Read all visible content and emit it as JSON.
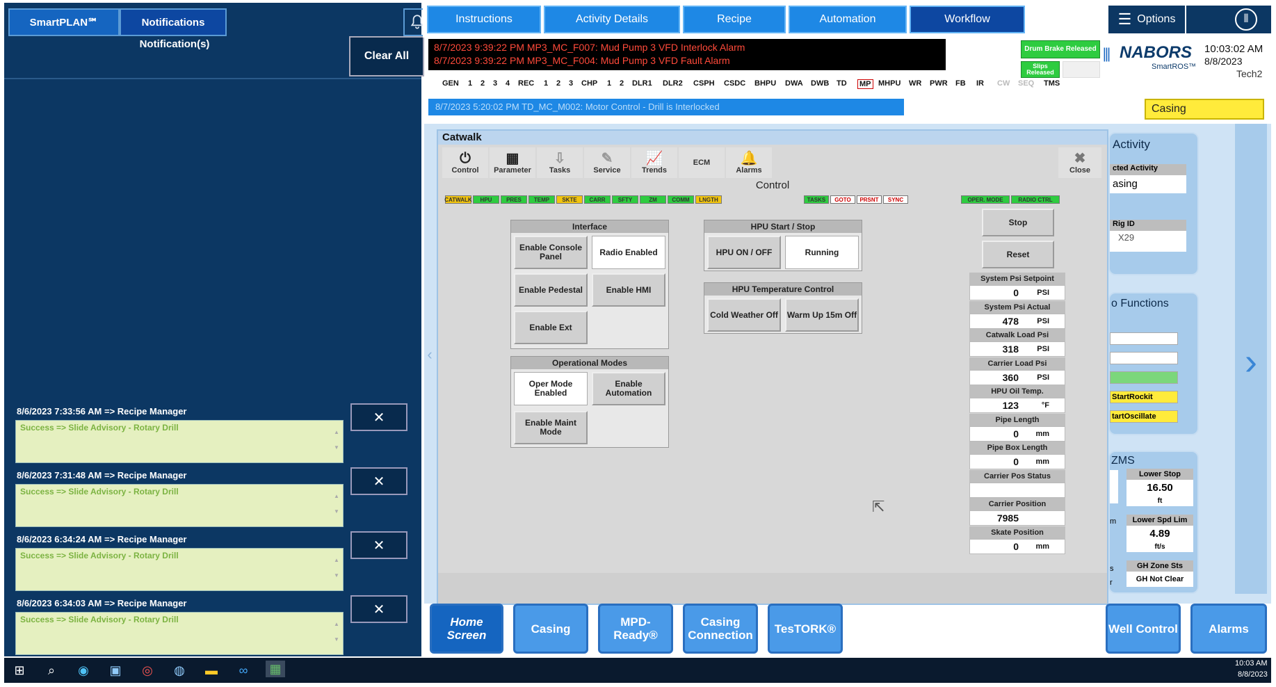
{
  "left": {
    "tabs": [
      "SmartPLAN℠",
      "Notifications"
    ],
    "panel_title": "Notification(s)",
    "clear_all": "Clear All",
    "notifications": [
      {
        "header": "8/6/2023 7:33:56 AM => Recipe Manager",
        "message": "Success => Slide Advisory - Rotary Drill"
      },
      {
        "header": "8/6/2023 7:31:48 AM => Recipe Manager",
        "message": "Success => Slide Advisory - Rotary Drill"
      },
      {
        "header": "8/6/2023 6:34:24 AM => Recipe Manager",
        "message": "Success => Slide Advisory - Rotary Drill"
      },
      {
        "header": "8/6/2023 6:34:03 AM => Recipe Manager",
        "message": "Success => Slide Advisory - Rotary Drill"
      }
    ],
    "dismiss": "✕"
  },
  "nav": {
    "tabs": [
      "Instructions",
      "Activity Details",
      "Recipe",
      "Automation",
      "Workflow"
    ],
    "options": "Options"
  },
  "alarms": [
    "8/7/2023 9:39:22 PM    MP3_MC_F007: Mud Pump 3 VFD Interlock Alarm",
    "8/7/2023 9:39:22 PM    MP3_MC_F004: Mud Pump 3 VFD Fault Alarm"
  ],
  "brake": {
    "drum": "Drum Brake Released",
    "slips": "Slips Released"
  },
  "brand": {
    "name": "NABORS",
    "sub": "SmartROS™",
    "time": "10:03:02 AM",
    "date": "8/8/2023",
    "user": "Tech2"
  },
  "status_labels": [
    "GEN",
    "1",
    "2",
    "3",
    "4",
    "REC",
    "1",
    "2",
    "3",
    "CHP",
    "1",
    "2",
    "DLR1",
    "DLR2",
    "CSPH",
    "CSDC",
    "BHPU",
    "DWA",
    "DWB",
    "TD",
    "MP",
    "MHPU",
    "WR",
    "PWR",
    "FB",
    "IR",
    "CW",
    "SEQ",
    "TMS"
  ],
  "info_message": "8/7/2023 5:20:02 PM       TD_MC_M002: Motor Control - Drill is Interlocked",
  "activity_badge": "Casing",
  "catwalk": {
    "title": "Catwalk",
    "toolbar": [
      {
        "label": "Control",
        "icon": "power-icon"
      },
      {
        "label": "Parameter",
        "icon": "calculator-icon"
      },
      {
        "label": "Tasks",
        "icon": "tasks-icon"
      },
      {
        "label": "Service",
        "icon": "service-icon"
      },
      {
        "label": "Trends",
        "icon": "trends-icon"
      },
      {
        "label": "ECM",
        "icon": ""
      },
      {
        "label": "Alarms",
        "icon": "bell-icon"
      }
    ],
    "close": "Close",
    "section_title": "Control",
    "status_segments_left": [
      {
        "label": "CATWALK",
        "color": "#f1c40f"
      },
      {
        "label": "HPU",
        "color": "#2ecc40"
      },
      {
        "label": "PRES",
        "color": "#2ecc40"
      },
      {
        "label": "TEMP",
        "color": "#2ecc40"
      },
      {
        "label": "SKTE",
        "color": "#f1c40f"
      },
      {
        "label": "CARR",
        "color": "#2ecc40"
      },
      {
        "label": "SFTY",
        "color": "#2ecc40"
      },
      {
        "label": "ZM",
        "color": "#2ecc40"
      },
      {
        "label": "COMM",
        "color": "#2ecc40"
      },
      {
        "label": "LNGTH",
        "color": "#f1c40f"
      }
    ],
    "status_segments_mid": [
      {
        "label": "TASKS",
        "color": "#2ecc40"
      },
      {
        "label": "GOTO",
        "color": "#ffffff"
      },
      {
        "label": "PRSNT",
        "color": "#ffffff"
      },
      {
        "label": "SYNC",
        "color": "#ffffff"
      }
    ],
    "status_segments_right": [
      {
        "label": "OPER. MODE",
        "color": "#2ecc40"
      },
      {
        "label": "RADIO CTRL",
        "color": "#2ecc40"
      }
    ],
    "interface": {
      "title": "Interface",
      "enable_console": "Enable Console Panel",
      "radio_enabled": "Radio Enabled",
      "enable_pedestal": "Enable Pedestal",
      "enable_hmi": "Enable HMI",
      "enable_ext": "Enable Ext"
    },
    "hpu": {
      "title": "HPU Start / Stop",
      "onoff": "HPU ON / OFF",
      "running": "Running",
      "temp_title": "HPU Temperature Control",
      "cold": "Cold Weather Off",
      "warm": "Warm Up 15m Off"
    },
    "modes": {
      "title": "Operational Modes",
      "oper": "Oper Mode Enabled",
      "auto": "Enable Automation",
      "maint": "Enable Maint Mode"
    },
    "stop": "Stop",
    "reset": "Reset",
    "readouts": [
      {
        "label": "System Psi Setpoint",
        "value": "0",
        "unit": "PSI"
      },
      {
        "label": "System Psi Actual",
        "value": "478",
        "unit": "PSI"
      },
      {
        "label": "Catwalk Load Psi",
        "value": "318",
        "unit": "PSI"
      },
      {
        "label": "Carrier Load Psi",
        "value": "360",
        "unit": "PSI"
      },
      {
        "label": "HPU Oil Temp.",
        "value": "123",
        "unit": "°F"
      },
      {
        "label": "Pipe Length",
        "value": "0",
        "unit": "mm"
      },
      {
        "label": "Pipe Box Length",
        "value": "0",
        "unit": "mm"
      },
      {
        "label": "Carrier Pos Status",
        "value": "",
        "unit": ""
      },
      {
        "label": "Carrier Position",
        "value": "7985",
        "unit": ""
      },
      {
        "label": "Skate Position",
        "value": "0",
        "unit": "mm"
      }
    ]
  },
  "right": {
    "activity_title": "Activity",
    "selected_label": "cted Activity",
    "selected_value": "asing",
    "rig_label": "Rig ID",
    "rig_value": "X29",
    "functions_title": "o Functions",
    "fn_rockit": "StartRockit",
    "fn_oscillate": "tartOscillate",
    "zms_title": "ZMS",
    "lower_stop_label": "Lower Stop",
    "lower_stop_value": "16.50",
    "lower_stop_unit": "ft",
    "lower_spd_label": "Lower Spd Lim",
    "lower_spd_value": "4.89",
    "lower_spd_unit": "ft/s",
    "gh_zone_label": "GH Zone Sts",
    "gh_zone_value": "GH Not Clear",
    "frag_m": "m",
    "frag_s": "s",
    "frag_r": "r"
  },
  "bottom_buttons": [
    "Home Screen",
    "Casing",
    "MPD-Ready®",
    "Casing Connection",
    "TesTORK®",
    "Well Control",
    "Alarms"
  ],
  "taskbar": {
    "time": "10:03 AM",
    "date": "8/8/2023"
  }
}
